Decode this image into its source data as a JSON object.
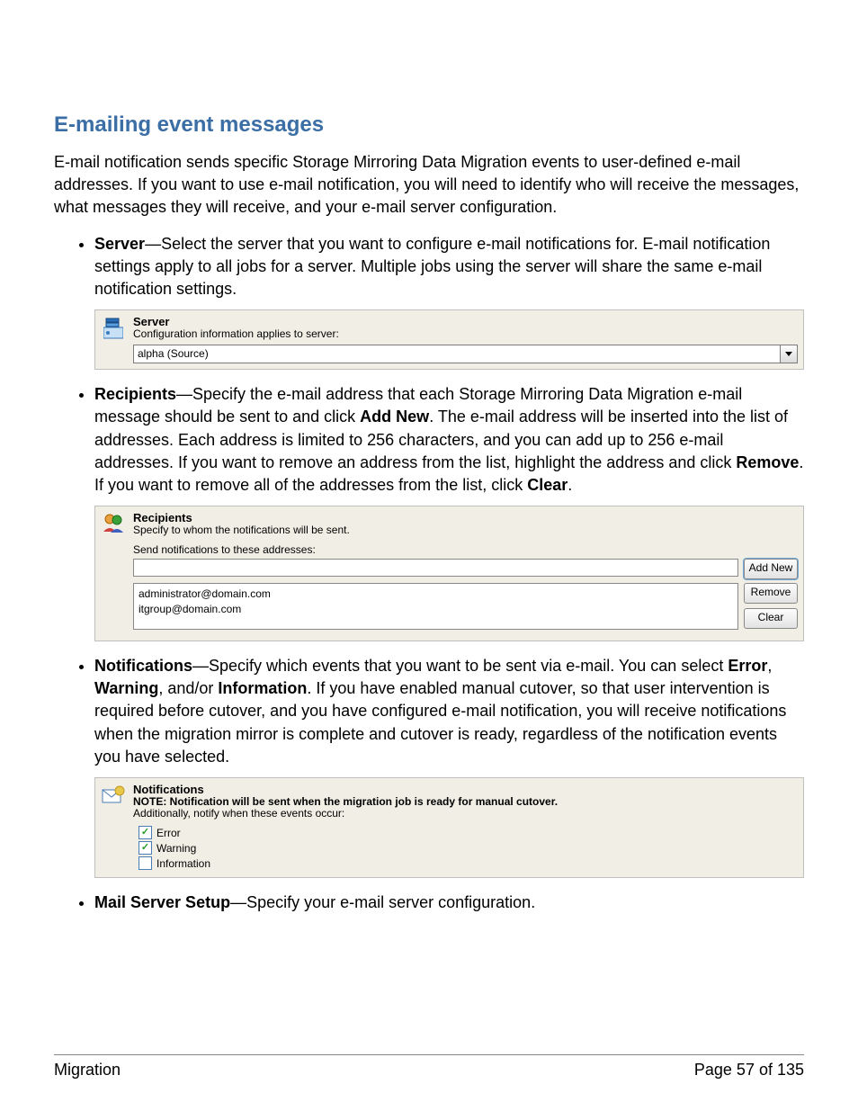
{
  "title": "E-mailing event messages",
  "intro": "E-mail notification sends specific Storage Mirroring Data Migration events to user-defined e-mail addresses. If you want to use e-mail notification, you will need to identify who will receive the messages, what messages they will receive, and your e-mail server configuration.",
  "bullets": {
    "server": {
      "label": "Server",
      "text": "—Select the server that you want to configure e-mail notifications for. E-mail notification settings apply to all jobs for a server. Multiple jobs using the server will share the same e-mail notification settings."
    },
    "recipients": {
      "label": "Recipients",
      "text_parts": [
        "—Specify the e-mail address that each Storage Mirroring Data Migration e-mail message should be sent to and click ",
        ". The e-mail address will be inserted into the list of addresses. Each address is limited to 256 characters, and you can add up to 256 e-mail addresses. If you want to remove an address from the list, highlight the address and click ",
        ". If you want to remove all of the addresses from the list, click ",
        "."
      ],
      "bold1": "Add New",
      "bold2": "Remove",
      "bold3": "Clear"
    },
    "notifications": {
      "label": "Notifications",
      "prefix": "—Specify which events that you want to be sent via e-mail. You can select ",
      "b1": "Error",
      "sep1": ", ",
      "b2": "Warning",
      "sep2": ", and/or ",
      "b3": "Information",
      "suffix": ". If you have enabled manual cutover, so that user intervention is required before cutover, and you have configured e-mail notification, you will receive notifications when the migration mirror is complete and cutover is ready, regardless of the notification events you have selected."
    },
    "mailserver": {
      "label": "Mail Server Setup",
      "text": "—Specify your e-mail server configuration."
    }
  },
  "panel_server": {
    "title": "Server",
    "sub": "Configuration information applies to server:",
    "value": "alpha (Source)"
  },
  "panel_recipients": {
    "title": "Recipients",
    "sub": "Specify to whom the notifications will be sent.",
    "label": "Send notifications to these addresses:",
    "addresses": [
      "administrator@domain.com",
      "itgroup@domain.com"
    ],
    "btn_add": "Add New",
    "btn_remove": "Remove",
    "btn_clear": "Clear"
  },
  "panel_notifications": {
    "title": "Notifications",
    "note": "NOTE: Notification will be sent when the migration job is ready for manual cutover.",
    "sub": "Additionally, notify when these events occur:",
    "opts": [
      {
        "label": "Error",
        "checked": true
      },
      {
        "label": "Warning",
        "checked": true
      },
      {
        "label": "Information",
        "checked": false
      }
    ]
  },
  "footer": {
    "left": "Migration",
    "right": "Page 57 of 135"
  }
}
